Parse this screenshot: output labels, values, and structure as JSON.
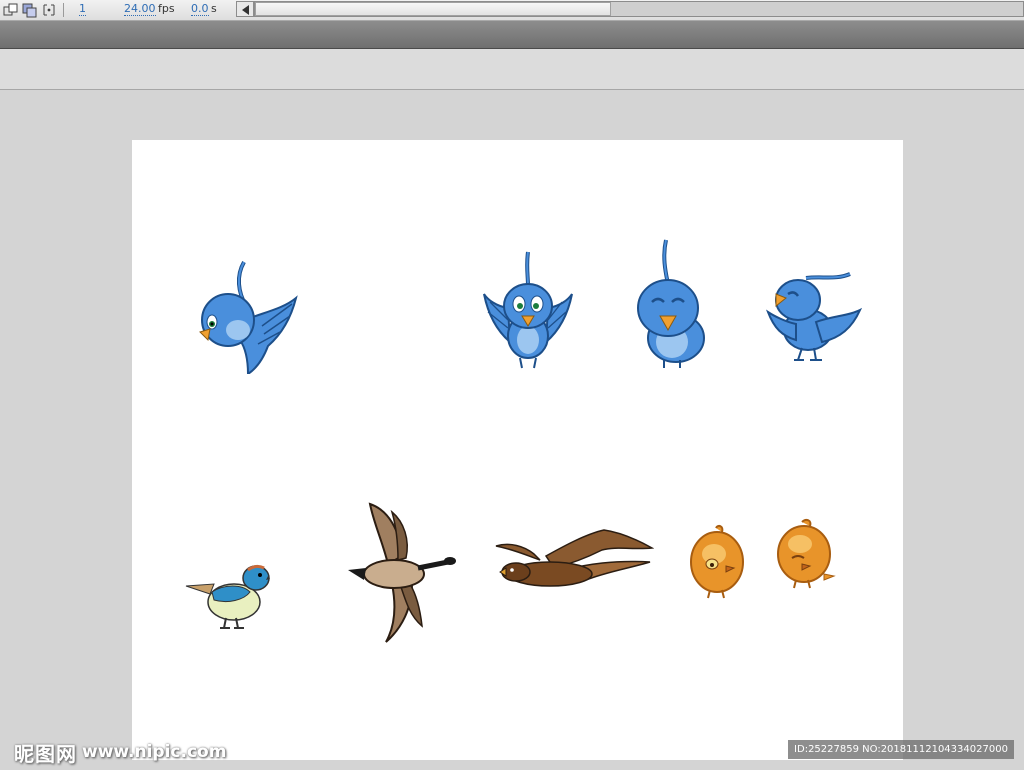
{
  "toolbar": {
    "icons": [
      "center-frame-icon",
      "onion-skin-icon",
      "edit-markers-icon"
    ],
    "current_frame": "1",
    "frame_rate": "24.00",
    "frame_rate_unit": "fps",
    "elapsed_time": "0.0",
    "elapsed_time_unit": "s"
  },
  "stage": {
    "background": "#ffffff",
    "sprites": [
      "blue-bird-flying-icon",
      "blue-bird-front-wings-icon",
      "blue-bird-happy-icon",
      "blue-bird-singing-icon",
      "small-songbird-icon",
      "canada-goose-icon",
      "eagle-gliding-icon",
      "orange-chick-icon",
      "orange-chick-side-icon"
    ]
  },
  "colors": {
    "blue_bird": "#4a8fdc",
    "blue_bird_light": "#9cc6f0",
    "beak": "#f0a030",
    "goose": "#a07f60",
    "eagle": "#8a5a30",
    "chick": "#e8942a",
    "accent": "#2f6db5"
  },
  "watermark": {
    "site": "昵图网",
    "url": "www.nipic.com",
    "id_text": "ID:25227859 NO:20181112104334027000"
  }
}
